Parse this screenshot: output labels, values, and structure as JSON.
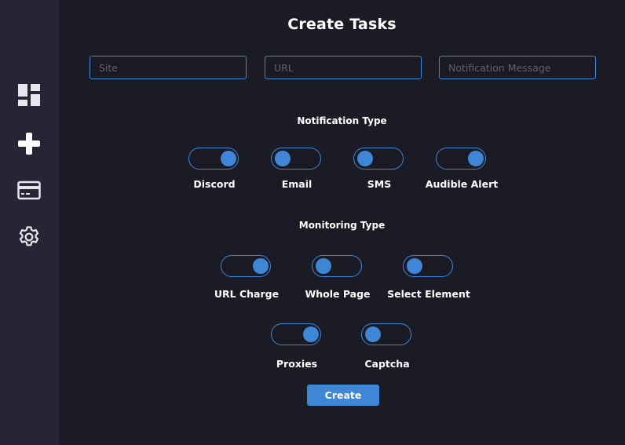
{
  "page": {
    "title": "Create Tasks"
  },
  "sidebar": {
    "items": [
      {
        "icon": "dashboard-icon"
      },
      {
        "icon": "plus-icon"
      },
      {
        "icon": "credit-card-icon"
      },
      {
        "icon": "gear-icon"
      }
    ]
  },
  "form": {
    "site_placeholder": "Site",
    "url_placeholder": "URL",
    "notification_placeholder": "Notification Message"
  },
  "notification_type": {
    "label": "Notification Type",
    "toggles": [
      {
        "label": "Discord",
        "on": true
      },
      {
        "label": "Email",
        "on": false
      },
      {
        "label": "SMS",
        "on": false
      },
      {
        "label": "Audible Alert",
        "on": true
      }
    ]
  },
  "monitoring_type": {
    "label": "Monitoring Type",
    "toggles": [
      {
        "label": "URL Charge",
        "on": true
      },
      {
        "label": "Whole Page",
        "on": false
      },
      {
        "label": "Select Element",
        "on": false
      }
    ]
  },
  "extras": {
    "toggles": [
      {
        "label": "Proxies",
        "on": true
      },
      {
        "label": "Captcha",
        "on": false
      }
    ]
  },
  "create_button": {
    "label": "Create"
  },
  "colors": {
    "accent": "#3f87d6",
    "background": "#1b1b25",
    "sidebar": "#252536"
  }
}
